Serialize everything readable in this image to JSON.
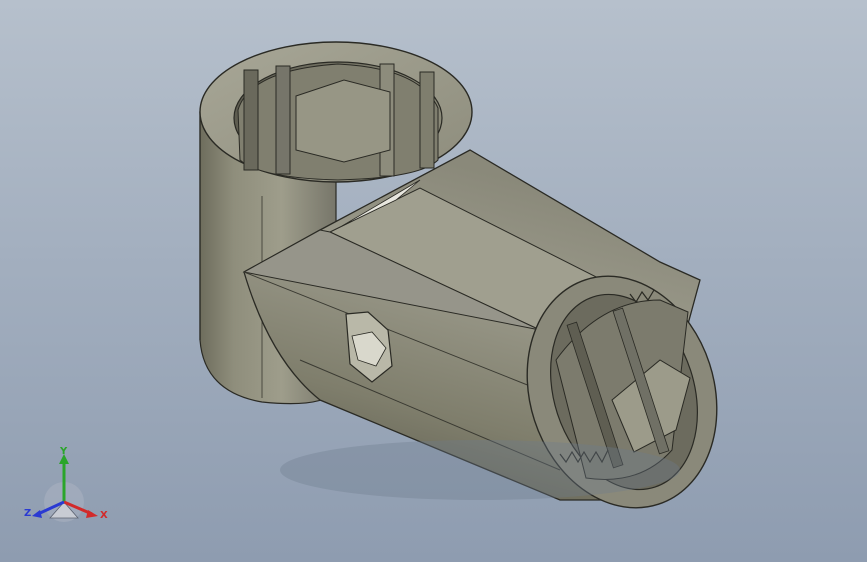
{
  "viewport": {
    "background_top": "#b6c0cc",
    "background_bottom": "#8e9cb0"
  },
  "model": {
    "description_icon": "cad-part",
    "body_color": "#8c8b79",
    "edge_color": "#2a2a24"
  },
  "triad": {
    "x_label": "X",
    "y_label": "Y",
    "z_label": "Z",
    "x_color": "#d22a2a",
    "y_color": "#2aa52a",
    "z_color": "#2a3ad2"
  }
}
